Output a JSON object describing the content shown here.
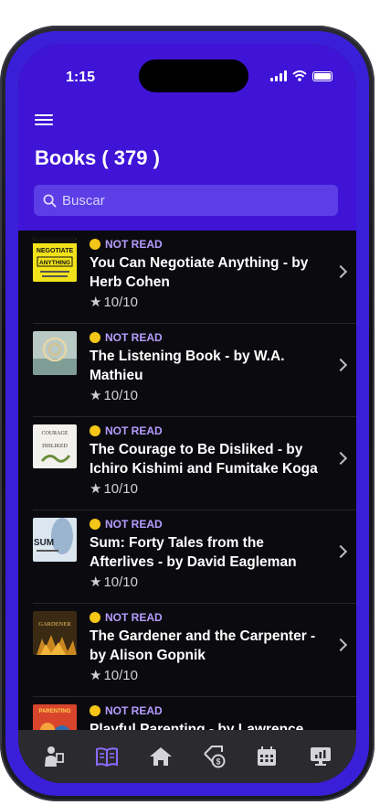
{
  "status_bar": {
    "time": "1:15"
  },
  "header": {
    "title": "Books ( 379 )",
    "search_placeholder": "Buscar"
  },
  "books": [
    {
      "status": "NOT READ",
      "title": "You Can Negotiate Anything - by Herb Cohen",
      "rating": "10/10",
      "cover_text": "YOU CAN NEGOTIATE ANYTHING"
    },
    {
      "status": "NOT READ",
      "title": "The Listening Book - by W.A. Mathieu",
      "rating": "10/10",
      "cover_text": ""
    },
    {
      "status": "NOT READ",
      "title": "The Courage to Be Disliked - by Ichiro Kishimi and Fumitake Koga",
      "rating": "10/10",
      "cover_text": "COURAGE TO BE DISLIKED"
    },
    {
      "status": "NOT READ",
      "title": "Sum: Forty Tales from the Afterlives - by David Eagleman",
      "rating": "10/10",
      "cover_text": "SUM"
    },
    {
      "status": "NOT READ",
      "title": "The Gardener and the Carpenter - by Alison Gopnik",
      "rating": "10/10",
      "cover_text": "GARDENER"
    },
    {
      "status": "NOT READ",
      "title": "Playful Parenting - by Lawrence",
      "rating": "",
      "cover_text": "PARENTING"
    }
  ],
  "nav": [
    {
      "icon": "person-board-icon",
      "active": false
    },
    {
      "icon": "book-open-icon",
      "active": true
    },
    {
      "icon": "home-icon",
      "active": false
    },
    {
      "icon": "price-tag-dollar-icon",
      "active": false
    },
    {
      "icon": "calendar-icon",
      "active": false
    },
    {
      "icon": "monitor-chart-icon",
      "active": false
    }
  ],
  "colors": {
    "header_bg": "#3f14d6",
    "accent_active": "#8b6cff",
    "status_text": "#b59cff",
    "status_dot": "#f5c518"
  }
}
